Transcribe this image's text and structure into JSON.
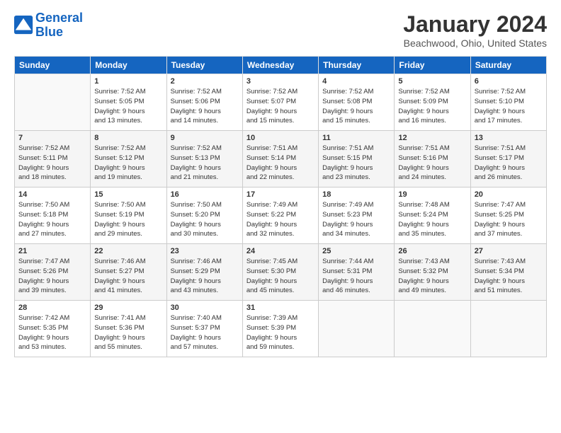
{
  "logo": {
    "line1": "General",
    "line2": "Blue"
  },
  "title": "January 2024",
  "location": "Beachwood, Ohio, United States",
  "headers": [
    "Sunday",
    "Monday",
    "Tuesday",
    "Wednesday",
    "Thursday",
    "Friday",
    "Saturday"
  ],
  "weeks": [
    [
      {
        "day": "",
        "info": ""
      },
      {
        "day": "1",
        "info": "Sunrise: 7:52 AM\nSunset: 5:05 PM\nDaylight: 9 hours\nand 13 minutes."
      },
      {
        "day": "2",
        "info": "Sunrise: 7:52 AM\nSunset: 5:06 PM\nDaylight: 9 hours\nand 14 minutes."
      },
      {
        "day": "3",
        "info": "Sunrise: 7:52 AM\nSunset: 5:07 PM\nDaylight: 9 hours\nand 15 minutes."
      },
      {
        "day": "4",
        "info": "Sunrise: 7:52 AM\nSunset: 5:08 PM\nDaylight: 9 hours\nand 15 minutes."
      },
      {
        "day": "5",
        "info": "Sunrise: 7:52 AM\nSunset: 5:09 PM\nDaylight: 9 hours\nand 16 minutes."
      },
      {
        "day": "6",
        "info": "Sunrise: 7:52 AM\nSunset: 5:10 PM\nDaylight: 9 hours\nand 17 minutes."
      }
    ],
    [
      {
        "day": "7",
        "info": "Sunrise: 7:52 AM\nSunset: 5:11 PM\nDaylight: 9 hours\nand 18 minutes."
      },
      {
        "day": "8",
        "info": "Sunrise: 7:52 AM\nSunset: 5:12 PM\nDaylight: 9 hours\nand 19 minutes."
      },
      {
        "day": "9",
        "info": "Sunrise: 7:52 AM\nSunset: 5:13 PM\nDaylight: 9 hours\nand 21 minutes."
      },
      {
        "day": "10",
        "info": "Sunrise: 7:51 AM\nSunset: 5:14 PM\nDaylight: 9 hours\nand 22 minutes."
      },
      {
        "day": "11",
        "info": "Sunrise: 7:51 AM\nSunset: 5:15 PM\nDaylight: 9 hours\nand 23 minutes."
      },
      {
        "day": "12",
        "info": "Sunrise: 7:51 AM\nSunset: 5:16 PM\nDaylight: 9 hours\nand 24 minutes."
      },
      {
        "day": "13",
        "info": "Sunrise: 7:51 AM\nSunset: 5:17 PM\nDaylight: 9 hours\nand 26 minutes."
      }
    ],
    [
      {
        "day": "14",
        "info": "Sunrise: 7:50 AM\nSunset: 5:18 PM\nDaylight: 9 hours\nand 27 minutes."
      },
      {
        "day": "15",
        "info": "Sunrise: 7:50 AM\nSunset: 5:19 PM\nDaylight: 9 hours\nand 29 minutes."
      },
      {
        "day": "16",
        "info": "Sunrise: 7:50 AM\nSunset: 5:20 PM\nDaylight: 9 hours\nand 30 minutes."
      },
      {
        "day": "17",
        "info": "Sunrise: 7:49 AM\nSunset: 5:22 PM\nDaylight: 9 hours\nand 32 minutes."
      },
      {
        "day": "18",
        "info": "Sunrise: 7:49 AM\nSunset: 5:23 PM\nDaylight: 9 hours\nand 34 minutes."
      },
      {
        "day": "19",
        "info": "Sunrise: 7:48 AM\nSunset: 5:24 PM\nDaylight: 9 hours\nand 35 minutes."
      },
      {
        "day": "20",
        "info": "Sunrise: 7:47 AM\nSunset: 5:25 PM\nDaylight: 9 hours\nand 37 minutes."
      }
    ],
    [
      {
        "day": "21",
        "info": "Sunrise: 7:47 AM\nSunset: 5:26 PM\nDaylight: 9 hours\nand 39 minutes."
      },
      {
        "day": "22",
        "info": "Sunrise: 7:46 AM\nSunset: 5:27 PM\nDaylight: 9 hours\nand 41 minutes."
      },
      {
        "day": "23",
        "info": "Sunrise: 7:46 AM\nSunset: 5:29 PM\nDaylight: 9 hours\nand 43 minutes."
      },
      {
        "day": "24",
        "info": "Sunrise: 7:45 AM\nSunset: 5:30 PM\nDaylight: 9 hours\nand 45 minutes."
      },
      {
        "day": "25",
        "info": "Sunrise: 7:44 AM\nSunset: 5:31 PM\nDaylight: 9 hours\nand 46 minutes."
      },
      {
        "day": "26",
        "info": "Sunrise: 7:43 AM\nSunset: 5:32 PM\nDaylight: 9 hours\nand 49 minutes."
      },
      {
        "day": "27",
        "info": "Sunrise: 7:43 AM\nSunset: 5:34 PM\nDaylight: 9 hours\nand 51 minutes."
      }
    ],
    [
      {
        "day": "28",
        "info": "Sunrise: 7:42 AM\nSunset: 5:35 PM\nDaylight: 9 hours\nand 53 minutes."
      },
      {
        "day": "29",
        "info": "Sunrise: 7:41 AM\nSunset: 5:36 PM\nDaylight: 9 hours\nand 55 minutes."
      },
      {
        "day": "30",
        "info": "Sunrise: 7:40 AM\nSunset: 5:37 PM\nDaylight: 9 hours\nand 57 minutes."
      },
      {
        "day": "31",
        "info": "Sunrise: 7:39 AM\nSunset: 5:39 PM\nDaylight: 9 hours\nand 59 minutes."
      },
      {
        "day": "",
        "info": ""
      },
      {
        "day": "",
        "info": ""
      },
      {
        "day": "",
        "info": ""
      }
    ]
  ]
}
